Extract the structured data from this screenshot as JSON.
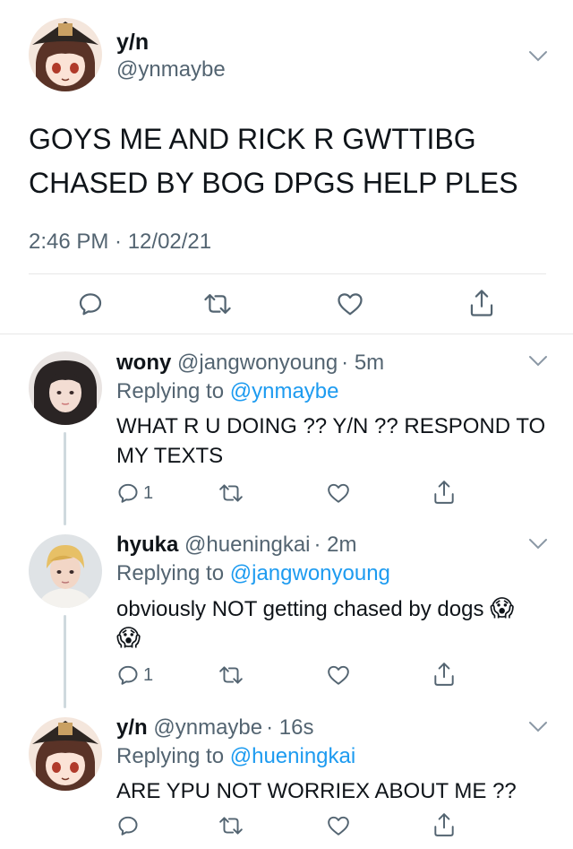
{
  "main_tweet": {
    "display_name": "y/n",
    "handle": "@ynmaybe",
    "text_line1": "GOYS ME AND RICK R GWTTIBG",
    "text_line2": "CHASED BY BOG DPGS HELP PLES",
    "timestamp": "2:46 PM · 12/02/21",
    "avatar_icon": "anime-hat-avatar-icon"
  },
  "replies": [
    {
      "display_name": "wony",
      "handle": "@jangwonyoung",
      "time": "· 5m",
      "replying_label": "Replying to",
      "replying_to": "@ynmaybe",
      "text_line1": "WHAT R U DOING ?? Y/N ?? RESPOND TO",
      "text_line2": "MY TEXTS",
      "reply_count": "1"
    },
    {
      "display_name": "hyuka",
      "handle": "@hueningkai",
      "time": "· 2m",
      "replying_label": "Replying to",
      "replying_to": "@jangwonyoung",
      "text_line1": "obviously NOT getting chased by dogs",
      "emoji": "😱",
      "reply_count": "1"
    },
    {
      "display_name": "y/n",
      "handle": "@ynmaybe",
      "time": "· 16s",
      "replying_label": "Replying to",
      "replying_to": "@hueningkai",
      "text_line1": "ARE YPU NOT WORRIEX ABOUT ME ??"
    }
  ],
  "colors": {
    "link": "#1d9bf0",
    "secondary_text": "#536471",
    "divider": "#e7e7e7",
    "thread_line": "#cfd9de"
  }
}
